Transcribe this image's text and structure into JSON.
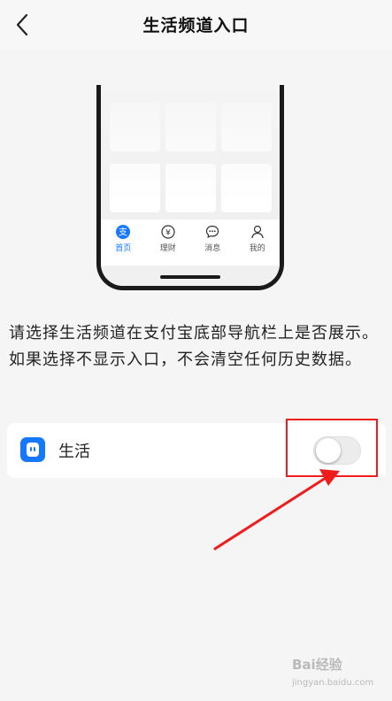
{
  "header": {
    "title": "生活频道入口",
    "back_icon": "chevron-left-icon"
  },
  "phone_preview": {
    "tabs": [
      {
        "label": "首页",
        "icon": "alipay-home-icon",
        "active": true
      },
      {
        "label": "理财",
        "icon": "yen-icon",
        "active": false
      },
      {
        "label": "消息",
        "icon": "chat-bubble-icon",
        "active": false
      },
      {
        "label": "我的",
        "icon": "person-icon",
        "active": false
      }
    ]
  },
  "description": "请选择生活频道在支付宝底部导航栏上是否展示。如果选择不显示入口，不会清空任何历史数据。",
  "setting": {
    "label": "生活",
    "icon": "life-app-icon",
    "enabled": false
  },
  "colors": {
    "accent": "#1677ff",
    "annotation": "#ee1c1c",
    "background": "#f5f5f5"
  },
  "watermark": {
    "brand": "Bai经验",
    "url": "jingyan.baidu.com"
  }
}
